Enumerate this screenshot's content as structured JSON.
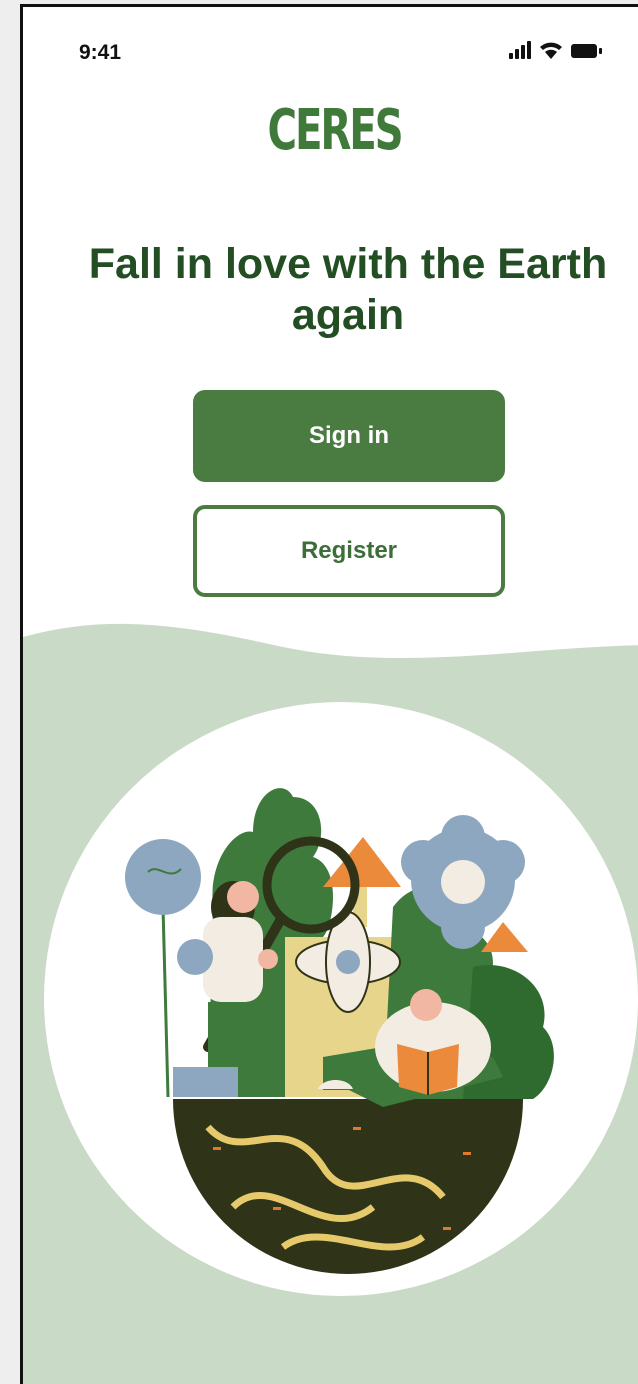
{
  "status_bar": {
    "time": "9:41",
    "icons": [
      "signal-icon",
      "wifi-icon",
      "battery-icon"
    ]
  },
  "app": {
    "logo": "CERES"
  },
  "hero": {
    "headline": "Fall in love with the Earth again"
  },
  "actions": {
    "sign_in_label": "Sign in",
    "register_label": "Register"
  },
  "colors": {
    "primary_green": "#4a7c42",
    "headline_green": "#234e24",
    "sage_background": "#c9dac6"
  }
}
